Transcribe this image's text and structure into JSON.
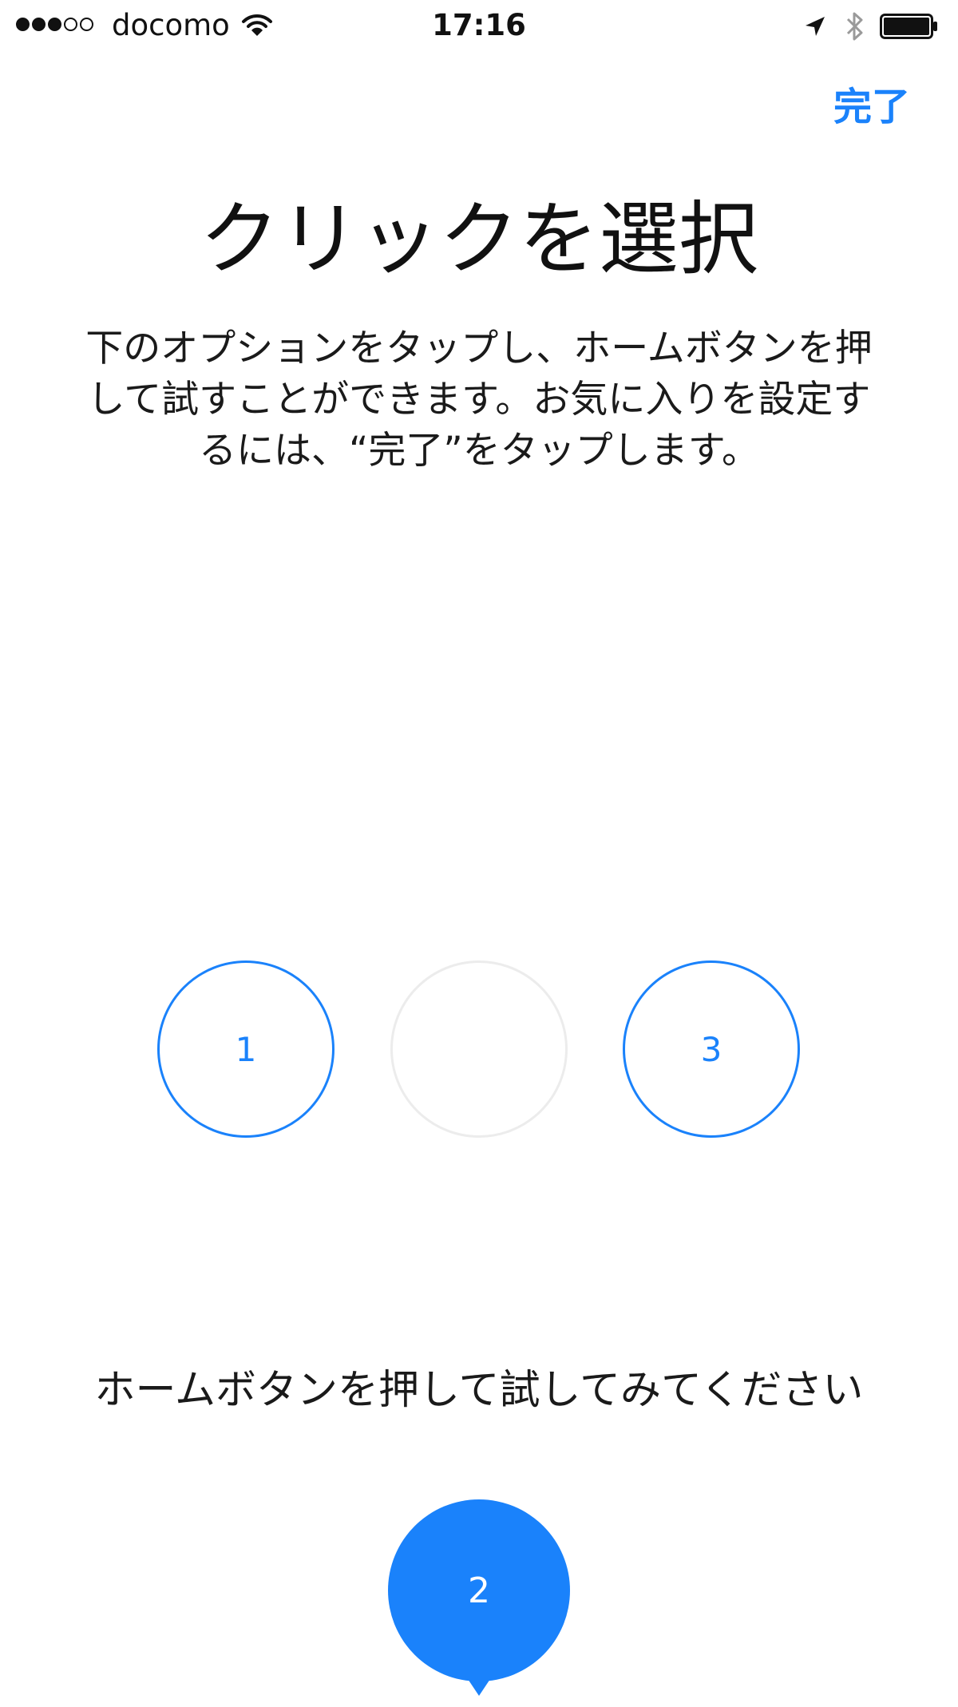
{
  "status_bar": {
    "signal_bars_filled": 3,
    "signal_bars_total": 5,
    "carrier": "docomo",
    "time": "17:16",
    "icons": [
      "wifi-icon",
      "location-arrow-icon",
      "bluetooth-icon",
      "battery-icon"
    ],
    "battery_level": 1.0
  },
  "nav": {
    "done_label": "完了"
  },
  "header": {
    "title": "クリックを選択",
    "description": "下のオプションをタップし、ホームボタンを押して試すことができます。お気に入りを設定するには、“完了”をタップします。"
  },
  "options": [
    {
      "label": "1",
      "state": "available"
    },
    {
      "label": "",
      "state": "selected-empty"
    },
    {
      "label": "3",
      "state": "available"
    }
  ],
  "prompt": "ホームボタンを押して試してみてください",
  "selected_bubble": {
    "label": "2"
  },
  "colors": {
    "accent": "#1a82fb",
    "inactive_border": "#ececec",
    "text": "#1a1a1a",
    "background": "#ffffff"
  }
}
